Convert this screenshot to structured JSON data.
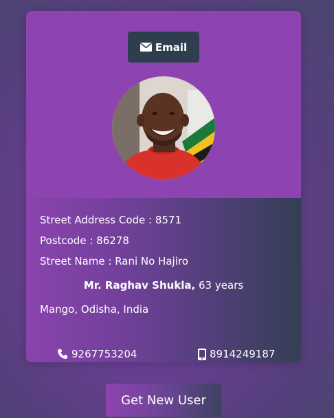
{
  "card": {
    "email_button_label": "Email",
    "email_icon": "envelope-icon",
    "avatar": "user-portrait",
    "street_address_code": "Street Address Code : 8571",
    "postcode": "Postcode : 86278",
    "street_name": "Street Name : Rani No Hajiro",
    "name": "Mr. Raghav Shukla,",
    "age": " 63 years",
    "location": "Mango, Odisha, India",
    "phone": "9267753204",
    "phone_icon": "phone-icon",
    "cell": "8914249187",
    "cell_icon": "mobile-icon"
  },
  "actions": {
    "get_new_user_label": "Get New User"
  },
  "colors": {
    "card_top": "#8d43b0",
    "email_button": "#2f3e4f",
    "accent_dark": "#333f55"
  }
}
